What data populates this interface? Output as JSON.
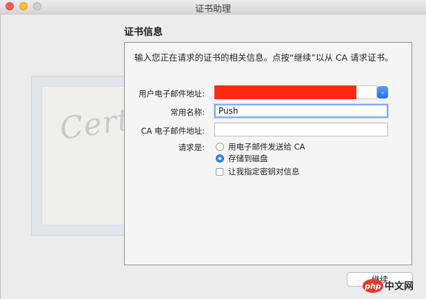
{
  "window": {
    "title": "证书助理"
  },
  "certificate": {
    "watermark_text": "Certificate"
  },
  "section": {
    "title": "证书信息",
    "intro": "输入您正在请求的证书的相关信息。点按“继续”以从 CA 请求证书。"
  },
  "form": {
    "email_label": "用户电子邮件地址:",
    "email_value": "",
    "name_label": "常用名称:",
    "name_value": "Push",
    "ca_email_label": "CA 电子邮件地址:",
    "ca_email_value": "",
    "request_label": "请求是:",
    "request_options": [
      {
        "label": "用电子邮件发送给 CA",
        "selected": false
      },
      {
        "label": "存储到磁盘",
        "selected": true
      }
    ],
    "checkbox_label": "让我指定密钥对信息",
    "checkbox_checked": false
  },
  "buttons": {
    "continue": "继续"
  },
  "overlay": {
    "badge": "php",
    "text": "中文网"
  },
  "colors": {
    "redacted": "#ff2a10",
    "accent": "#3b85f5"
  }
}
